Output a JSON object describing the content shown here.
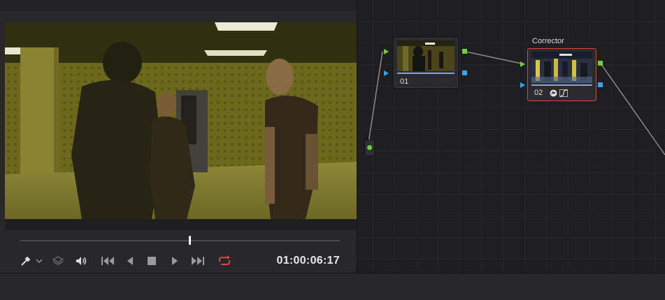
{
  "viewer": {
    "timecode": "01:00:06:17",
    "playhead_fraction": 0.53,
    "loop_enabled": true,
    "colors": {
      "loop_active": "#e0453b",
      "playhead": "#f2f2f2"
    }
  },
  "transport": {
    "eyedropper_icon": "eyedropper-icon",
    "dropdown_icon": "chevron-down-icon",
    "layers_icon": "layers-icon",
    "volume_icon": "speaker-icon",
    "first_frame_icon": "skip-to-start-icon",
    "reverse_icon": "play-reverse-icon",
    "stop_icon": "stop-icon",
    "play_icon": "play-icon",
    "last_frame_icon": "skip-to-end-icon",
    "loop_icon": "loop-icon"
  },
  "nodes": {
    "node1": {
      "label": "01"
    },
    "node2": {
      "title": "Corrector",
      "label": "02",
      "fx_icons": [
        "fx-icon",
        "curves-icon"
      ]
    }
  },
  "colors": {
    "rgb_port": "#6ad23a",
    "alpha_port": "#36a5ea",
    "selected_node_border": "#d8473f"
  }
}
